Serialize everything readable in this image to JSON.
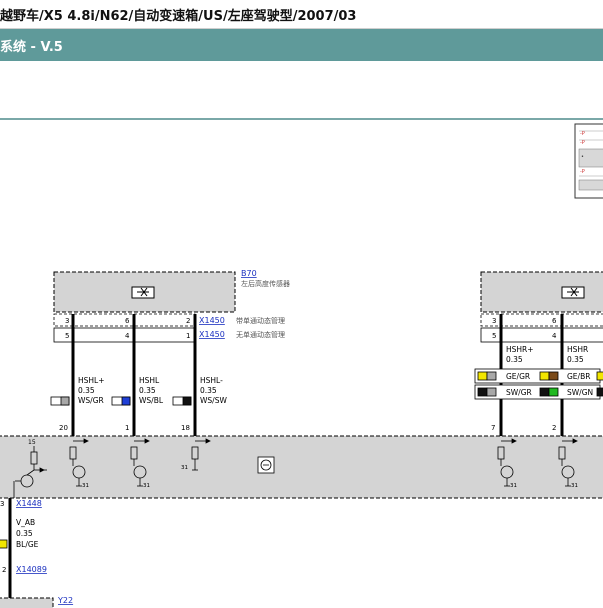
{
  "header": {
    "title": "越野车/X5 4.8i/N62/自动变速箱/US/左座驾驶型/2007/03",
    "section": "系统 - V.5"
  },
  "diagram": {
    "sensor_left": {
      "ref": "B70",
      "name": "左后高度传感器",
      "connector_ref": "X1450",
      "connector_ref_2": "X1450",
      "variant_with": "带单通动态管理",
      "variant_without": "无单通动态管理",
      "pins_row1": [
        "3",
        "6",
        "2"
      ],
      "pins_row2": [
        "5",
        "4",
        "1"
      ]
    },
    "wires_left": [
      {
        "signal": "HSHL+",
        "size": "0.35",
        "color_code": "WS/GR",
        "swatch_color": "#a8a8a8"
      },
      {
        "signal": "HSHL",
        "size": "0.35",
        "color_code": "WS/BL",
        "swatch_color": "#1f3fd6"
      },
      {
        "signal": "HSHL-",
        "size": "0.35",
        "color_code": "WS/SW",
        "swatch_color": "#111111"
      }
    ],
    "ecu_pins_left": [
      "20",
      "1",
      "18"
    ],
    "sensor_right": {
      "pins_row1": [
        "3",
        "6"
      ],
      "pins_row2": [
        "5",
        "4"
      ]
    },
    "wires_right": [
      {
        "signal": "HSHR+",
        "size": "0.35",
        "color_code_1": "GE/GR",
        "color_code_2": "SW/GR"
      },
      {
        "signal": "HSHR",
        "size": "0.35",
        "color_code_1": "GE/BR",
        "color_code_2": "SW/GN"
      }
    ],
    "ecu_pins_right": [
      "7",
      "2"
    ],
    "ecu_labels": {
      "pin15": "15",
      "ground_31": "31"
    },
    "lower_left": {
      "pin_top": "3",
      "connector_top": "X1448",
      "signal": "V_AB",
      "size": "0.35",
      "color_code": "BL/GE",
      "pin_bottom": "2",
      "connector_bottom": "X14089",
      "component_ref": "Y22"
    },
    "colors": {
      "teal_bar": "#5f9a9a",
      "component_fill": "#d4d4d4",
      "link_blue": "#1a2fbf"
    }
  }
}
